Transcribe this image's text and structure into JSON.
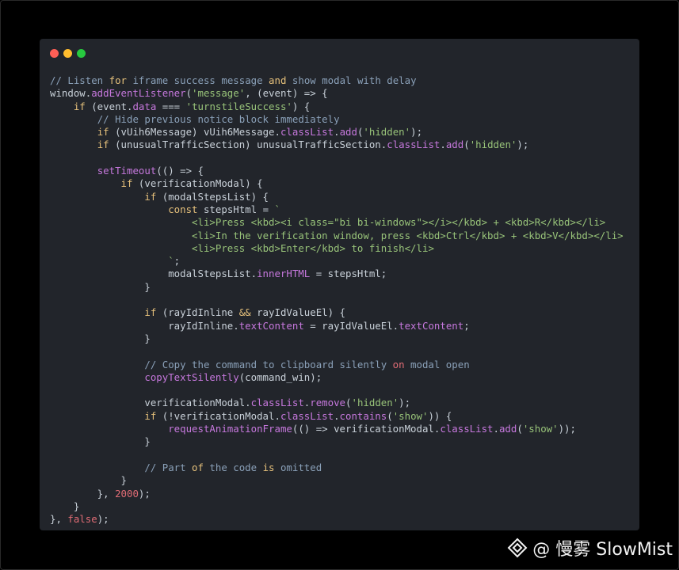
{
  "window": {
    "traffic_lights": [
      {
        "name": "close-dot",
        "color": "#ff5f56"
      },
      {
        "name": "minimize-dot",
        "color": "#ffbd2e"
      },
      {
        "name": "maximize-dot",
        "color": "#27c93f"
      }
    ]
  },
  "colors": {
    "background": "#000000",
    "window": "#22252b",
    "comment": "#8aa0b8",
    "keyword": "#e5c07b",
    "string": "#98c379",
    "property": "#c678dd",
    "number": "#e06c75"
  },
  "code_lines": [
    [
      [
        "comment",
        "// Listen "
      ],
      [
        "keyword",
        "for"
      ],
      [
        "comment",
        " iframe success message "
      ],
      [
        "keyword",
        "and"
      ],
      [
        "comment",
        " show modal with delay"
      ]
    ],
    [
      [
        "plain",
        "window."
      ],
      [
        "prop",
        "addEventListener"
      ],
      [
        "plain",
        "("
      ],
      [
        "string",
        "'message'"
      ],
      [
        "plain",
        ", (event) => {"
      ]
    ],
    [
      [
        "plain",
        "    "
      ],
      [
        "keyword",
        "if"
      ],
      [
        "plain",
        " (event."
      ],
      [
        "prop",
        "data"
      ],
      [
        "plain",
        " === "
      ],
      [
        "string",
        "'turnstileSuccess'"
      ],
      [
        "plain",
        ") {"
      ]
    ],
    [
      [
        "plain",
        "        "
      ],
      [
        "comment",
        "// Hide previous notice block immediately"
      ]
    ],
    [
      [
        "plain",
        "        "
      ],
      [
        "keyword",
        "if"
      ],
      [
        "plain",
        " (vUih6Message) vUih6Message."
      ],
      [
        "prop",
        "classList"
      ],
      [
        "plain",
        "."
      ],
      [
        "prop",
        "add"
      ],
      [
        "plain",
        "("
      ],
      [
        "string",
        "'hidden'"
      ],
      [
        "plain",
        ");"
      ]
    ],
    [
      [
        "plain",
        "        "
      ],
      [
        "keyword",
        "if"
      ],
      [
        "plain",
        " (unusualTrafficSection) unusualTrafficSection."
      ],
      [
        "prop",
        "classList"
      ],
      [
        "plain",
        "."
      ],
      [
        "prop",
        "add"
      ],
      [
        "plain",
        "("
      ],
      [
        "string",
        "'hidden'"
      ],
      [
        "plain",
        ");"
      ]
    ],
    [],
    [
      [
        "plain",
        "        "
      ],
      [
        "prop",
        "setTimeout"
      ],
      [
        "plain",
        "(() => {"
      ]
    ],
    [
      [
        "plain",
        "            "
      ],
      [
        "keyword",
        "if"
      ],
      [
        "plain",
        " (verificationModal) {"
      ]
    ],
    [
      [
        "plain",
        "                "
      ],
      [
        "keyword",
        "if"
      ],
      [
        "plain",
        " (modalStepsList) {"
      ]
    ],
    [
      [
        "plain",
        "                    "
      ],
      [
        "keyword",
        "const"
      ],
      [
        "plain",
        " stepsHtml = "
      ],
      [
        "string",
        "`"
      ]
    ],
    [
      [
        "plain",
        "                        "
      ],
      [
        "string",
        "<li>Press <kbd><i class=\"bi bi-windows\"></i></kbd> + <kbd>R</kbd></li>"
      ]
    ],
    [
      [
        "plain",
        "                        "
      ],
      [
        "string",
        "<li>In the verification window, press <kbd>Ctrl</kbd> + <kbd>V</kbd></li>"
      ]
    ],
    [
      [
        "plain",
        "                        "
      ],
      [
        "string",
        "<li>Press <kbd>Enter</kbd> to finish</li>"
      ]
    ],
    [
      [
        "plain",
        "                    "
      ],
      [
        "string",
        "`"
      ],
      [
        "plain",
        ";"
      ]
    ],
    [
      [
        "plain",
        "                    modalStepsList."
      ],
      [
        "prop",
        "innerHTML"
      ],
      [
        "plain",
        " = stepsHtml;"
      ]
    ],
    [
      [
        "plain",
        "                }"
      ]
    ],
    [],
    [
      [
        "plain",
        "                "
      ],
      [
        "keyword",
        "if"
      ],
      [
        "plain",
        " (rayIdInline "
      ],
      [
        "keyword",
        "&&"
      ],
      [
        "plain",
        " rayIdValueEl) {"
      ]
    ],
    [
      [
        "plain",
        "                    rayIdInline."
      ],
      [
        "prop",
        "textContent"
      ],
      [
        "plain",
        " = rayIdValueEl."
      ],
      [
        "prop",
        "textContent"
      ],
      [
        "plain",
        ";"
      ]
    ],
    [
      [
        "plain",
        "                }"
      ]
    ],
    [],
    [
      [
        "plain",
        "                "
      ],
      [
        "comment",
        "// Copy the command to clipboard silently "
      ],
      [
        "num",
        "on"
      ],
      [
        "comment",
        " modal open"
      ]
    ],
    [
      [
        "plain",
        "                "
      ],
      [
        "prop",
        "copyTextSilently"
      ],
      [
        "plain",
        "(command_win);"
      ]
    ],
    [],
    [
      [
        "plain",
        "                verificationModal."
      ],
      [
        "prop",
        "classList"
      ],
      [
        "plain",
        "."
      ],
      [
        "prop",
        "remove"
      ],
      [
        "plain",
        "("
      ],
      [
        "string",
        "'hidden'"
      ],
      [
        "plain",
        ");"
      ]
    ],
    [
      [
        "plain",
        "                "
      ],
      [
        "keyword",
        "if"
      ],
      [
        "plain",
        " (!verificationModal."
      ],
      [
        "prop",
        "classList"
      ],
      [
        "plain",
        "."
      ],
      [
        "prop",
        "contains"
      ],
      [
        "plain",
        "("
      ],
      [
        "string",
        "'show'"
      ],
      [
        "plain",
        ")) {"
      ]
    ],
    [
      [
        "plain",
        "                    "
      ],
      [
        "prop",
        "requestAnimationFrame"
      ],
      [
        "plain",
        "(() => verificationModal."
      ],
      [
        "prop",
        "classList"
      ],
      [
        "plain",
        "."
      ],
      [
        "prop",
        "add"
      ],
      [
        "plain",
        "("
      ],
      [
        "string",
        "'show'"
      ],
      [
        "plain",
        "));"
      ]
    ],
    [
      [
        "plain",
        "                }"
      ]
    ],
    [],
    [
      [
        "plain",
        "                "
      ],
      [
        "comment",
        "// Part "
      ],
      [
        "keyword",
        "of"
      ],
      [
        "comment",
        " the code "
      ],
      [
        "keyword",
        "is"
      ],
      [
        "comment",
        " omitted"
      ]
    ],
    [
      [
        "plain",
        "            }"
      ]
    ],
    [
      [
        "plain",
        "        }, "
      ],
      [
        "num",
        "2000"
      ],
      [
        "plain",
        ");"
      ]
    ],
    [
      [
        "plain",
        "    }"
      ]
    ],
    [
      [
        "plain",
        "}, "
      ],
      [
        "bool",
        "false"
      ],
      [
        "plain",
        ");"
      ]
    ]
  ],
  "watermark": {
    "text": "@ 慢雾 SlowMist",
    "logo_icon": "slowmist-logo-icon"
  }
}
